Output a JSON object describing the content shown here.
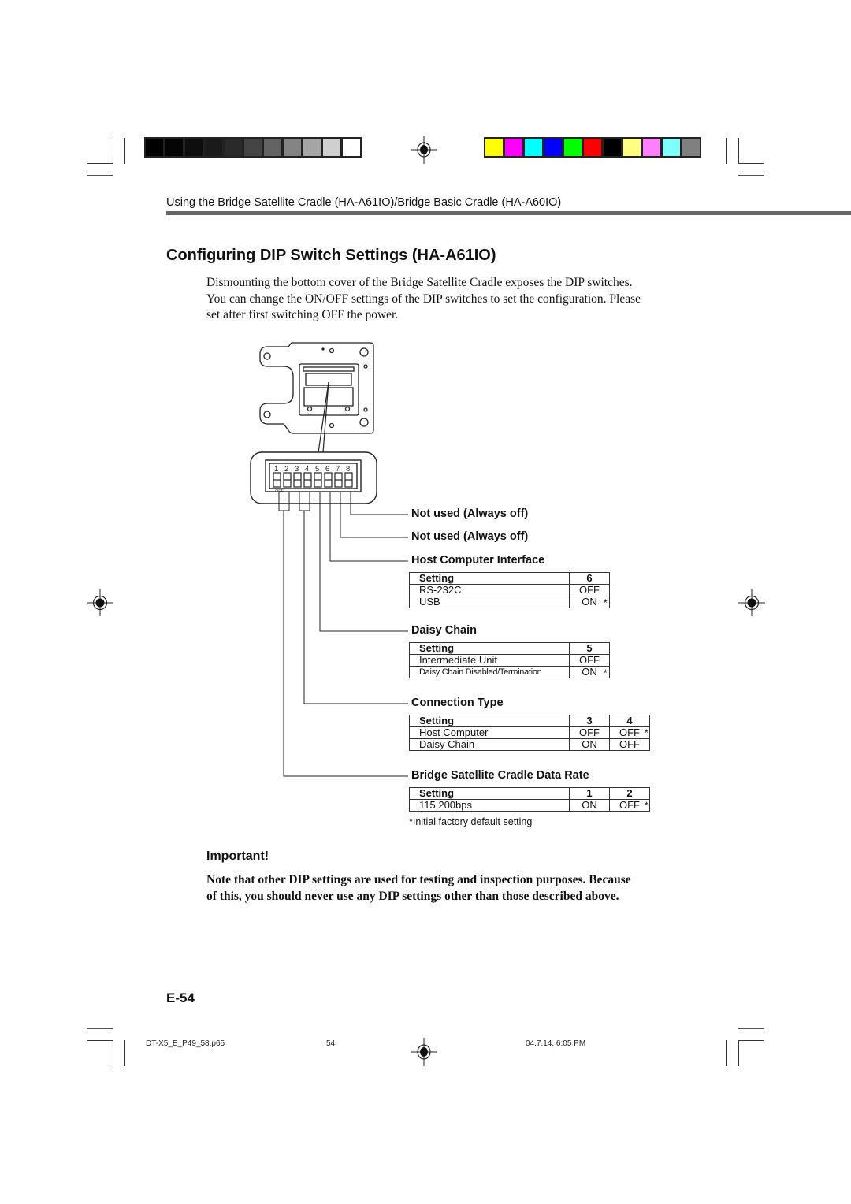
{
  "print_marks": {
    "grayscale_swatches": [
      "#000000",
      "#050505",
      "#0e0e0e",
      "#1a1a1a",
      "#2a2a2a",
      "#444444",
      "#636363",
      "#848484",
      "#a5a5a5",
      "#cfcfcf",
      "#ffffff"
    ],
    "color_swatches": [
      "#ffff00",
      "#ff00ff",
      "#00ffff",
      "#0000ff",
      "#00ff00",
      "#ff0000",
      "#000000",
      "#ffff80",
      "#ff80ff",
      "#80ffff",
      "#808080"
    ]
  },
  "header": {
    "running_title": "Using the Bridge Satellite Cradle (HA-A61IO)/Bridge Basic Cradle (HA-A60IO)"
  },
  "section": {
    "title": "Configuring DIP Switch Settings (HA-A61IO)",
    "intro_lines": [
      "Dismounting the bottom cover of the Bridge Satellite Cradle exposes the DIP switches.",
      "You can change the ON/OFF settings of the DIP switches to set the configuration. Please",
      "set after first switching OFF the power."
    ]
  },
  "diagram": {
    "switch_numbers": [
      "1",
      "2",
      "3",
      "4",
      "5",
      "6",
      "7",
      "8"
    ],
    "off_label": "OFF"
  },
  "groups": {
    "sw8": {
      "label": "Not used (Always off)"
    },
    "sw7": {
      "label": "Not used (Always off)"
    },
    "host_interface": {
      "label": "Host Computer Interface",
      "header": [
        "Setting",
        "6"
      ],
      "rows": [
        {
          "setting": "RS-232C",
          "values": [
            "OFF"
          ],
          "default": false
        },
        {
          "setting": "USB",
          "values": [
            "ON"
          ],
          "default": true
        }
      ]
    },
    "daisy_chain": {
      "label": "Daisy Chain",
      "header": [
        "Setting",
        "5"
      ],
      "rows": [
        {
          "setting": "Intermediate Unit",
          "values": [
            "OFF"
          ],
          "default": false
        },
        {
          "setting": "Daisy Chain Disabled/Termination",
          "values": [
            "ON"
          ],
          "default": true
        }
      ]
    },
    "connection_type": {
      "label": "Connection Type",
      "header": [
        "Setting",
        "3",
        "4"
      ],
      "rows": [
        {
          "setting": "Host Computer",
          "values": [
            "OFF",
            "OFF"
          ],
          "default": true
        },
        {
          "setting": "Daisy Chain",
          "values": [
            "ON",
            "OFF"
          ],
          "default": false
        }
      ]
    },
    "data_rate": {
      "label": "Bridge Satellite Cradle Data Rate",
      "header": [
        "Setting",
        "1",
        "2"
      ],
      "rows": [
        {
          "setting": "115,200bps",
          "values": [
            "ON",
            "OFF"
          ],
          "default": true
        }
      ]
    }
  },
  "default_marker": "*",
  "footnote": "*Initial factory default setting",
  "important": {
    "heading": "Important!",
    "lines": [
      "Note that other DIP settings are used for testing and inspection purposes. Because",
      "of this, you should never use any DIP settings other than those described above."
    ]
  },
  "page_number": "E-54",
  "footer": {
    "file_name": "DT-X5_E_P49_58.p65",
    "sheet_number": "54",
    "timestamp": "04.7.14, 6:05 PM"
  }
}
